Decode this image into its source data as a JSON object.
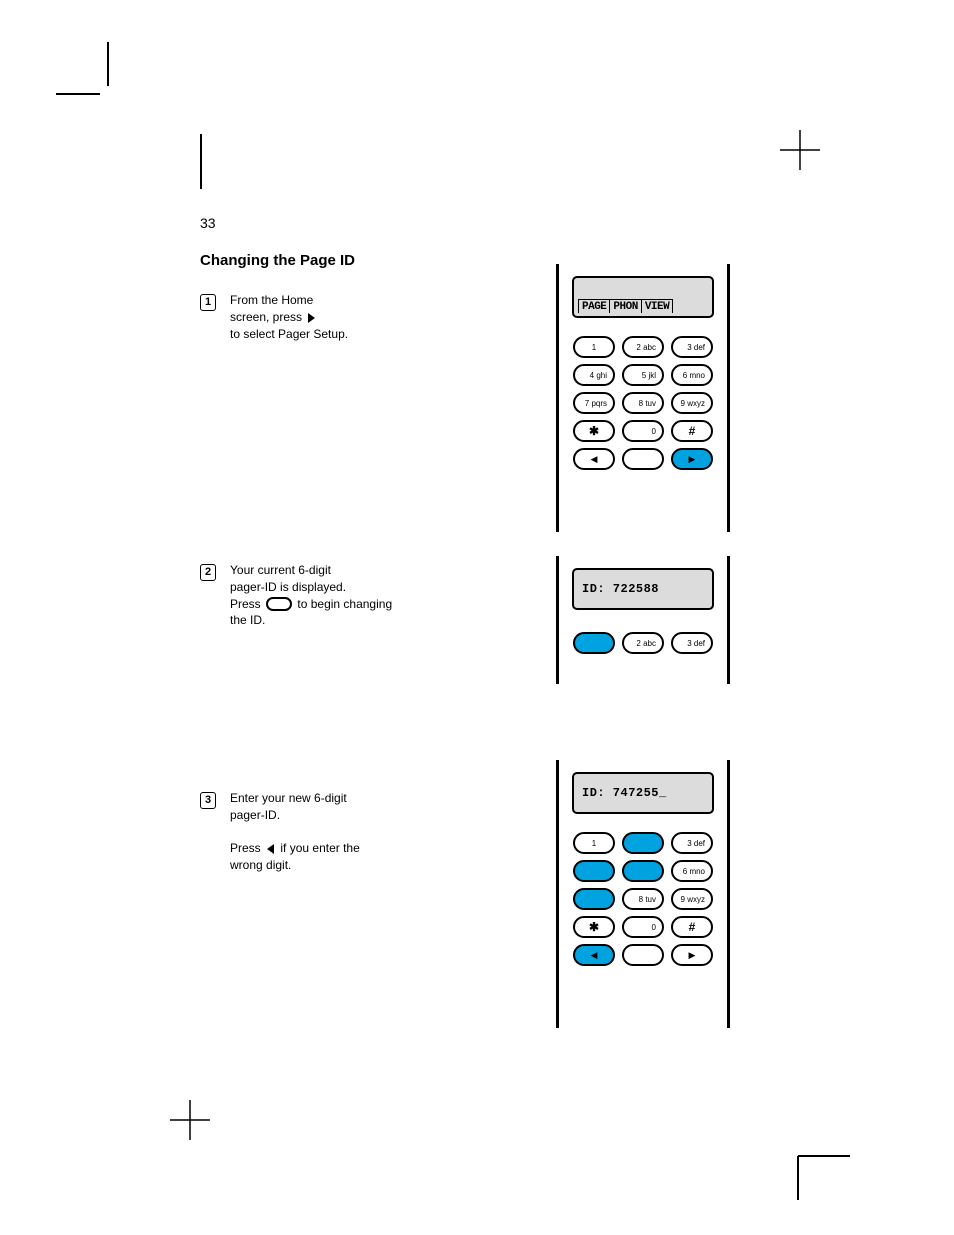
{
  "page_number": "33",
  "section_title": "Changing the Page ID",
  "para1_parts": {
    "a": "From the Home",
    "b": "screen, press",
    "c": "to select Pager Setup."
  },
  "bullet_mark": "1",
  "para2_parts": {
    "a": "Your current 6-digit",
    "b": "pager-ID is displayed.",
    "c": "Press",
    "d": "to begin changing",
    "e": "the ID."
  },
  "bullet_mark2": "2",
  "para3_parts": {
    "a": "Enter your new 6-digit",
    "b": "pager-ID.",
    "c": "Press",
    "d": "if you enter the",
    "e": "wrong digit."
  },
  "bullet_mark3": "3",
  "lcd1": {
    "tab1": "PAGE",
    "tab2": "PHON",
    "tab3": "VIEW"
  },
  "lcd2_text": "ID: 722588",
  "lcd3_text": "ID: 747255_",
  "keys": {
    "k1": "1",
    "k2": "2 abc",
    "k3": "3 def",
    "k4": "4 ghi",
    "k5": "5 jkl",
    "k6": "6 mno",
    "k7": "7 pqrs",
    "k8": "8 tuv",
    "k9": "9 wxyz",
    "kstar": "✱",
    "k0": "0",
    "khash": "#",
    "kleft": "◀",
    "kmenu": "",
    "kright": "▶"
  }
}
